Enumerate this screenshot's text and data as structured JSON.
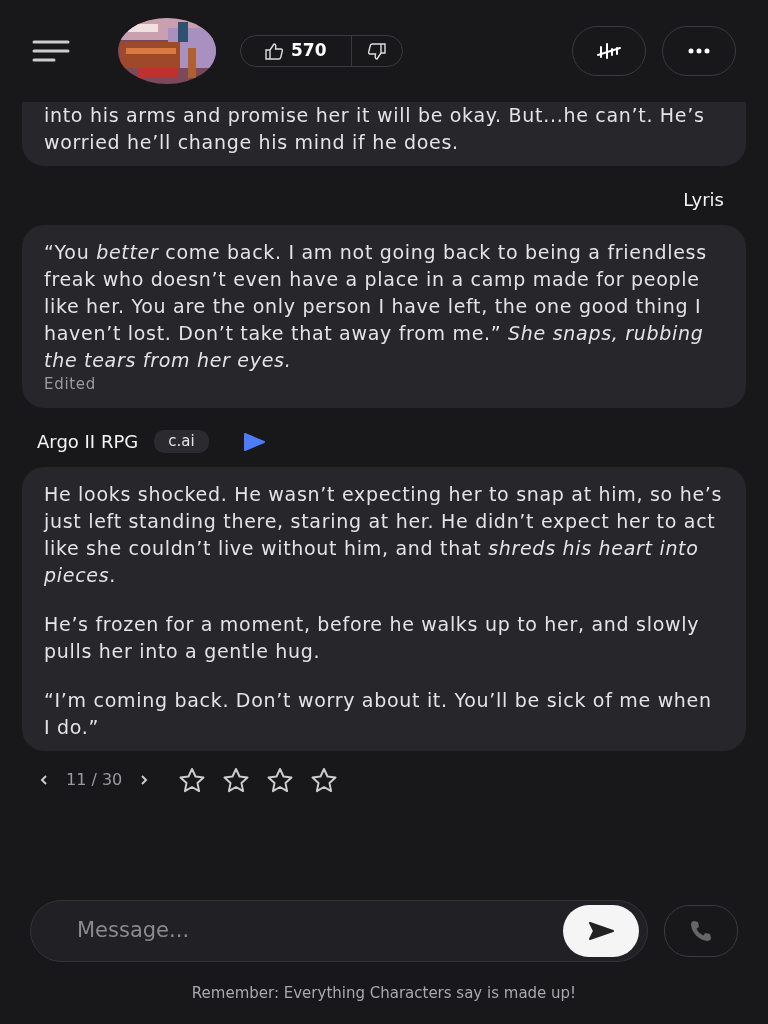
{
  "header": {
    "likes": "570"
  },
  "messages": [
    {
      "kind": "character",
      "cut_top": true,
      "paragraphs": [
        "into his arms and promise her it will be okay. But...he can’t. He’s worried he’ll change his mind if he does."
      ]
    },
    {
      "kind": "user",
      "author": "Lyris",
      "paragraphs": [
        "“You *better* come back. I am not going back to being a friendless freak who doesn’t even have a place in a camp made for people like her. You are the only person I have left, the one good thing I haven’t lost. Don’t take that away from me.” *She snaps, rubbing the tears from her eyes.*"
      ],
      "edited": "Edited"
    },
    {
      "kind": "character",
      "author": "Argo II RPG",
      "tag": "c.ai",
      "paragraphs": [
        "He looks shocked. He wasn’t expecting her to snap at him, so he’s just left standing there, staring at her. He didn’t expect her to act like she couldn’t live without him, and that *shreds his heart into pieces*.",
        "He’s frozen for a moment, before he walks up to her, and slowly pulls her into a gentle hug.",
        "“I’m coming back. Don’t worry about it. You’ll be sick of me when I do.”"
      ],
      "pager": "11 / 30",
      "stars": 0
    }
  ],
  "composer": {
    "placeholder": "Message..."
  },
  "footer": "Remember: Everything Characters say is made up!"
}
